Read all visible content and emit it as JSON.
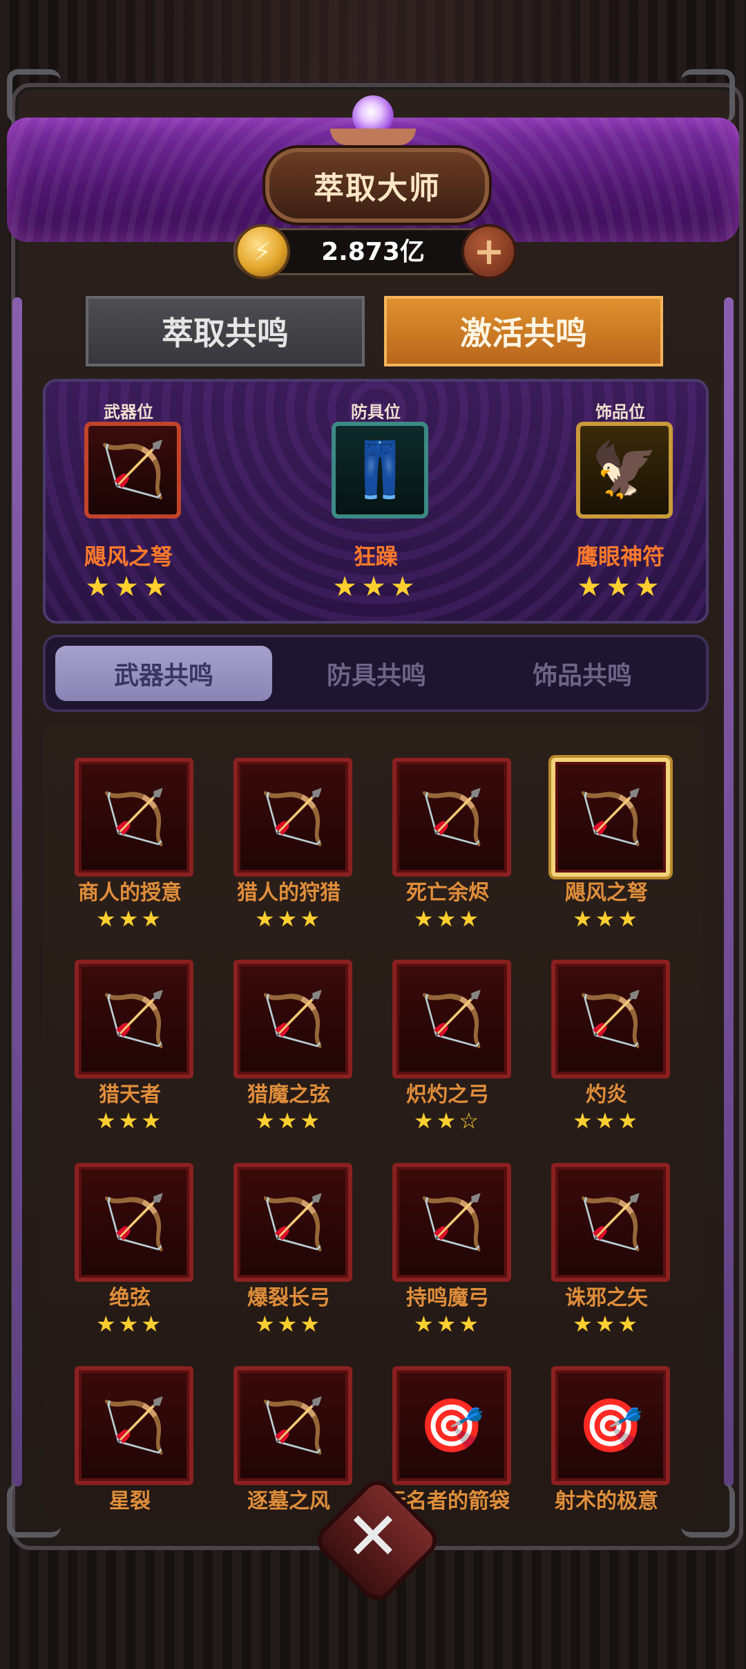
{
  "header": {
    "title": "萃取大师"
  },
  "currency": {
    "amount": "2.873亿",
    "add_label": "+",
    "coin_glyph": "⚡"
  },
  "tabs": [
    {
      "label": "萃取共鸣",
      "active": false
    },
    {
      "label": "激活共鸣",
      "active": true
    }
  ],
  "slots": [
    {
      "label": "武器位",
      "name": "飓风之弩",
      "stars": "★★★",
      "icon": "golden-crossbow-icon",
      "glyph": "🏹"
    },
    {
      "label": "防具位",
      "name": "狂躁",
      "stars": "★★★",
      "icon": "armor-pants-icon",
      "glyph": "👖"
    },
    {
      "label": "饰品位",
      "name": "鹰眼神符",
      "stars": "★★★",
      "icon": "eagle-charm-icon",
      "glyph": "🦅"
    }
  ],
  "subtabs": [
    {
      "label": "武器共鸣",
      "active": true
    },
    {
      "label": "防具共鸣",
      "active": false
    },
    {
      "label": "饰品共鸣",
      "active": false
    }
  ],
  "items": [
    {
      "name": "商人的授意",
      "stars": "★★★",
      "icon": "crossbow-icon",
      "glyph": "🏹",
      "selected": false
    },
    {
      "name": "猎人的狩猎",
      "stars": "★★★",
      "icon": "crossbow-icon",
      "glyph": "🏹",
      "selected": false
    },
    {
      "name": "死亡余烬",
      "stars": "★★★",
      "icon": "bow-icon",
      "glyph": "🏹",
      "selected": false
    },
    {
      "name": "飓风之弩",
      "stars": "★★★",
      "icon": "golden-crossbow-icon",
      "glyph": "🏹",
      "selected": true
    },
    {
      "name": "猎天者",
      "stars": "★★★",
      "icon": "bow-icon",
      "glyph": "🏹",
      "selected": false
    },
    {
      "name": "猎魔之弦",
      "stars": "★★★",
      "icon": "crossbow-icon",
      "glyph": "🏹",
      "selected": false
    },
    {
      "name": "炽灼之弓",
      "stars": "★★☆",
      "icon": "bow-icon",
      "glyph": "🏹",
      "selected": false
    },
    {
      "name": "灼炎",
      "stars": "★★★",
      "icon": "bow-icon",
      "glyph": "🏹",
      "selected": false
    },
    {
      "name": "绝弦",
      "stars": "★★★",
      "icon": "purple-bow-icon",
      "glyph": "🏹",
      "selected": false
    },
    {
      "name": "爆裂长弓",
      "stars": "★★★",
      "icon": "crossbow-icon",
      "glyph": "🏹",
      "selected": false
    },
    {
      "name": "持鸣魔弓",
      "stars": "★★★",
      "icon": "bow-icon",
      "glyph": "🏹",
      "selected": false
    },
    {
      "name": "诛邪之矢",
      "stars": "★★★",
      "icon": "green-bow-icon",
      "glyph": "🏹",
      "selected": false
    },
    {
      "name": "星裂",
      "stars": "",
      "icon": "cyan-bow-icon",
      "glyph": "🏹",
      "selected": false
    },
    {
      "name": "逐墓之风",
      "stars": "",
      "icon": "bow-icon",
      "glyph": "🏹",
      "selected": false
    },
    {
      "name": "无名者的箭袋",
      "stars": "",
      "icon": "quiver-icon",
      "glyph": "🎯",
      "selected": false
    },
    {
      "name": "射术的极意",
      "stars": "",
      "icon": "quiver-icon",
      "glyph": "🎯",
      "selected": false
    }
  ],
  "footer": {
    "close_glyph": "✕"
  }
}
